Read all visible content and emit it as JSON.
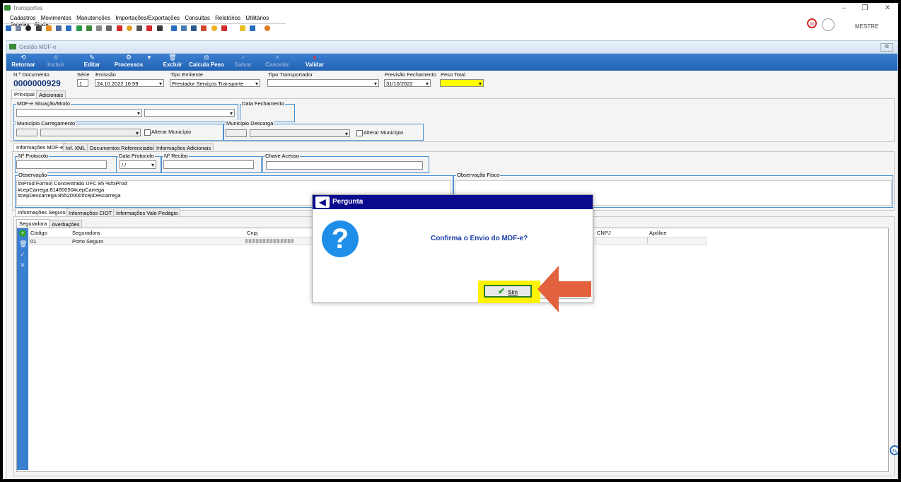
{
  "app": {
    "title": "Transportes",
    "user": "MESTRE",
    "notification_count": "00"
  },
  "menu": [
    "Cadastros",
    "Movimentos",
    "Manutenções",
    "Importações/Exportações",
    "Consultas",
    "Relatórios",
    "Utilitários",
    "Janelas",
    "Ajuda"
  ],
  "window": {
    "title": "Gestão MDF-e"
  },
  "ribbon": {
    "retornar": "Retornar",
    "incluir": "Incluir",
    "editar": "Editar",
    "processos": "Processos",
    "excluir": "Excluir",
    "calcula_peso": "Calcula Peso",
    "salvar": "Salvar",
    "cancelar": "Cancelar",
    "validar": "Validar"
  },
  "header": {
    "n_documento_label": "N.º Documento",
    "n_documento": "0000000929",
    "serie_label": "Série",
    "serie": "1",
    "emissao_label": "Emissão",
    "emissao": "24.10.2022 16:59",
    "tipo_emitente_label": "Tipo Emitente",
    "tipo_emitente": "Prestador Serviços Transporte",
    "tipo_transportador_label": "Tipo Transportador",
    "tipo_transportador": "",
    "previsao_label": "Previsão Fechamento",
    "previsao": "31/10/2022",
    "peso_total_label": "Peso Total",
    "peso_total": ""
  },
  "main_tabs": [
    "Principal",
    "Adicionais"
  ],
  "principal": {
    "mdfe_situacao_label": "MDF-e Situação/Modo",
    "data_fechamento_label": "Data Fechamento",
    "municipio_carregamento_label": "Município Carregamento",
    "municipio_descarga_label": "Município Descarga",
    "alterar_municipio": "Alterar Município"
  },
  "info_tabs": [
    "Informações MDF-e",
    "Inf. XML",
    "Documentos Referenciados",
    "Informações Adicionais"
  ],
  "info": {
    "n_protocolo_label": "Nº Protocolo",
    "data_protocolo_label": "Data Protocolo",
    "data_protocolo": " / /",
    "n_recibo_label": "Nº Recibo",
    "chave_acesso_label": "Chave Acesso",
    "observacao_label": "Observação",
    "observacao_lines": [
      "#xProd:Formol Concentrado UFC 85 %#xProd",
      "#cepCarrega:81460050#cepCarrega",
      "#cepDescarrega:85520000#cepDescarrega"
    ],
    "observacao_fisco_label": "Observação Fisco"
  },
  "seguro_tabs": [
    "Informações Seguro",
    "Informações CIOT",
    "Informações Vale Pedágio"
  ],
  "seguro_subtabs": [
    "Seguradora",
    "Averbações"
  ],
  "seguradora_table": {
    "columns": [
      "Código",
      "Seguradora",
      "Cnpj"
    ],
    "rows": [
      [
        "01",
        "Porto Seguro",
        ""
      ]
    ]
  },
  "right_table": {
    "columns": [
      "CNPJ",
      "Apólice"
    ]
  },
  "dialog": {
    "title": "Pergunta",
    "message": "Confirma o Envio do MDF-e?",
    "sim": "Sim"
  },
  "colors": {
    "ribbon": "#2a6cc0",
    "dialog_title": "#0b0b8f",
    "highlight": "#fff200",
    "arrow": "#e2623e"
  }
}
